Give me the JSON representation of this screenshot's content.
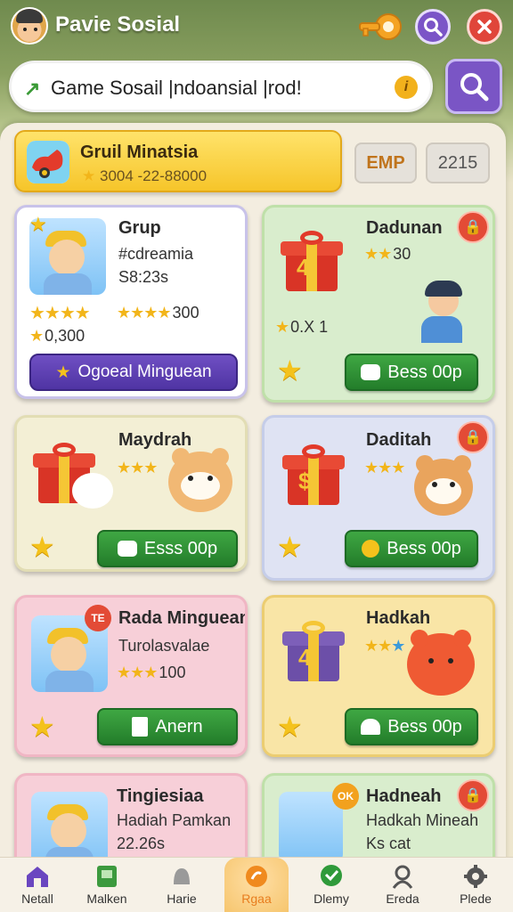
{
  "app": {
    "title": "Pavie Sosial"
  },
  "search": {
    "value": "Game Sosail |ndoansial |rod!",
    "info_glyph": "i"
  },
  "group_banner": {
    "title": "Gruil Minatsia",
    "subtitle": "3004 -22-88000"
  },
  "pills": {
    "emp": "EMP",
    "count": "2215"
  },
  "cards": [
    {
      "title": "Grup",
      "line1": "#cdreamia",
      "line2": "S8:23s",
      "stars_value": "300",
      "small_value": "0,300",
      "button": "Ogoeal Minguean"
    },
    {
      "title": "Dadunan",
      "stars_value": "30",
      "line1": "0.X 1",
      "button": "Bess 00p"
    },
    {
      "title": "Maydrah",
      "button": "Esss 00p"
    },
    {
      "title": "Daditah",
      "button": "Bess 00p"
    },
    {
      "title": "Rada Minguean",
      "badge": "TE",
      "line1": "Turolasvalae",
      "stars_value": "100",
      "button": "Anern"
    },
    {
      "title": "Hadkah",
      "button": "Bess 00p"
    },
    {
      "title": "Tingiesiaa",
      "line1": "Hadiah Pamkan",
      "line2": "22.26s"
    },
    {
      "title": "Hadneah",
      "badge": "OK",
      "line1": "Hadkah Mineah",
      "line2": "Ks cat"
    }
  ],
  "nav": [
    {
      "label": "Netall",
      "icon": "home-icon",
      "color": "#6a46c0"
    },
    {
      "label": "Malken",
      "icon": "map-icon",
      "color": "#3c9a3e"
    },
    {
      "label": "Harie",
      "icon": "bell-icon",
      "color": "#888888"
    },
    {
      "label": "Rgaa",
      "icon": "gift-icon",
      "color": "#e87d1e"
    },
    {
      "label": "Dlemy",
      "icon": "heart-chat-icon",
      "color": "#2f9a3a"
    },
    {
      "label": "Ereda",
      "icon": "user-icon",
      "color": "#555555"
    },
    {
      "label": "Plede",
      "icon": "gear-icon",
      "color": "#555555"
    }
  ]
}
